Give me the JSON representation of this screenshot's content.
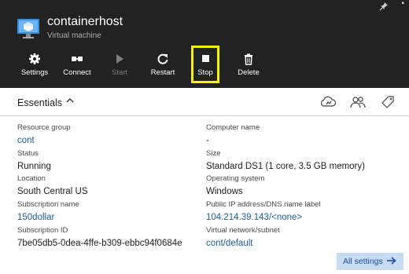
{
  "header": {
    "title": "containerhost",
    "subtitle": "Virtual machine"
  },
  "toolbar": {
    "settings": "Settings",
    "connect": "Connect",
    "start": "Start",
    "restart": "Restart",
    "stop": "Stop",
    "delete": "Delete"
  },
  "essentials": {
    "title": "Essentials",
    "left": [
      {
        "label": "Resource group",
        "value": "cont"
      },
      {
        "label": "Status",
        "value": "Running"
      },
      {
        "label": "Location",
        "value": "South Central US"
      },
      {
        "label": "Subscription name",
        "value": "150dollar"
      },
      {
        "label": "Subscription ID",
        "value": "7be05db5-0dea-4ffe-b309-ebbc94f0684e"
      }
    ],
    "right": [
      {
        "label": "Computer name",
        "value": "-"
      },
      {
        "label": "Size",
        "value": "Standard DS1 (1 core, 3.5 GB memory)"
      },
      {
        "label": "Operating system",
        "value": "Windows"
      },
      {
        "label": "Public IP address/DNS name label",
        "value": "104.214.39.143/<none>"
      },
      {
        "label": "Virtual network/subnet",
        "value": "cont/default"
      }
    ]
  },
  "all_settings_label": "All settings",
  "colors": {
    "header_bg": "#222222",
    "link": "#1a5ea8",
    "highlight": "#f5f500",
    "button_bg": "#c7dbf3"
  }
}
